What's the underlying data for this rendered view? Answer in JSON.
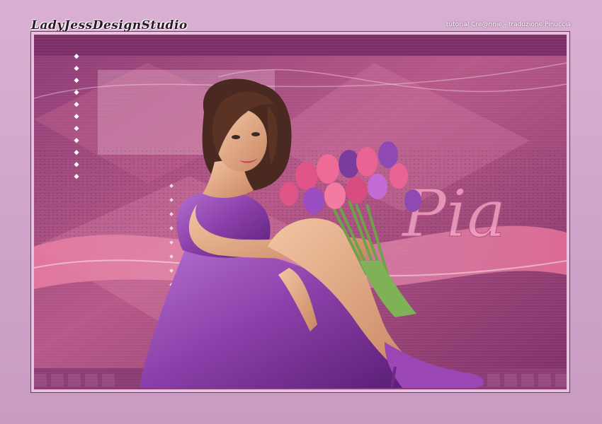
{
  "header": {
    "studio_signature": "LadyJessDesignStudio"
  },
  "credit": {
    "text": "tutorial Cre@nnie - traduzione Pinuccia"
  },
  "artwork": {
    "title_word": "Pia",
    "colors": {
      "frame": "#d3a6cd",
      "background_dark": "#7a2d64",
      "background_mid": "#b0507f",
      "accent_pink": "#e07aa0",
      "dress_purple": "#8a3fa8",
      "skin": "#e7b08c",
      "hair": "#4a2a20"
    }
  }
}
